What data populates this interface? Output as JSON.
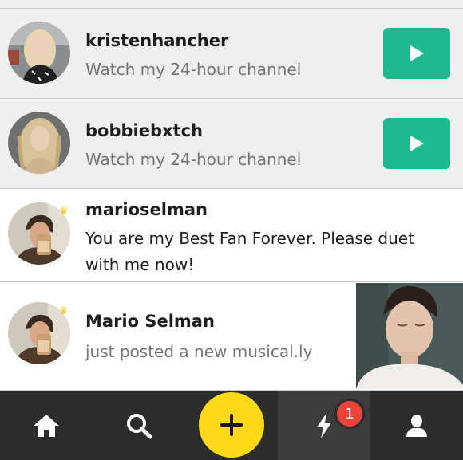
{
  "feed": {
    "channels": [
      {
        "username": "kristenhancher",
        "subtitle": "Watch my 24-hour channel",
        "action_icon": "play-icon",
        "accent": "#20b98f"
      },
      {
        "username": "bobbiebxtch",
        "subtitle": "Watch my 24-hour channel",
        "action_icon": "play-icon",
        "accent": "#20b98f"
      }
    ],
    "message": {
      "username": "marioselman",
      "text": "You are my Best Fan Forever. Please duet with me now!",
      "badge_icon": "crown-icon"
    },
    "post": {
      "username": "Mario Selman",
      "subtitle": "just posted a new musical.ly",
      "badge_icon": "crown-icon"
    }
  },
  "tabbar": {
    "items": [
      "home-icon",
      "search-icon",
      "create-plus-icon",
      "notifications-bolt-icon",
      "profile-icon"
    ],
    "notification_count": "1",
    "colors": {
      "bar": "#2c2c2c",
      "create": "#ffd91a",
      "badge": "#e8443a"
    }
  }
}
